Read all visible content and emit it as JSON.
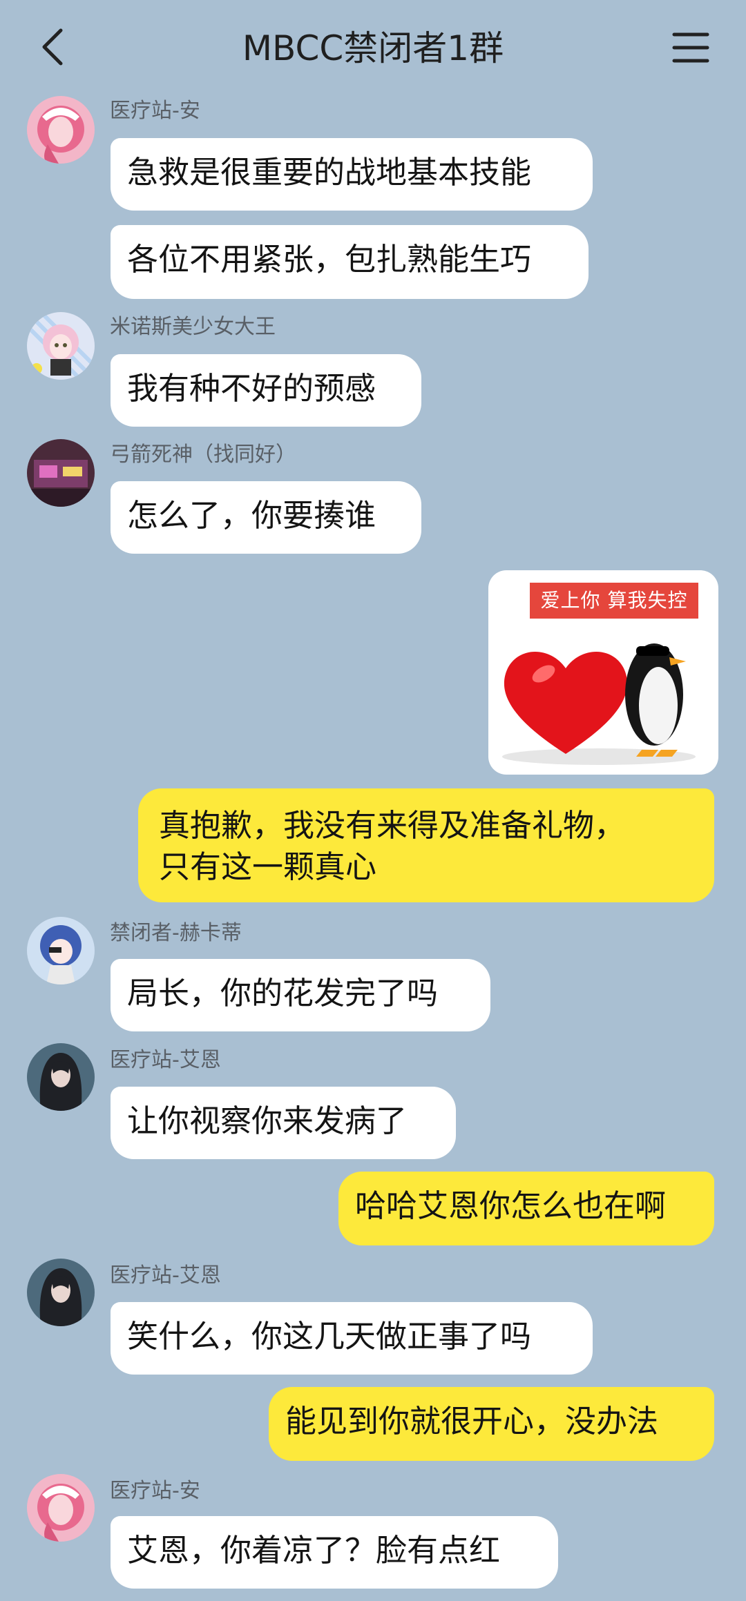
{
  "header": {
    "title": "MBCC禁闭者1群",
    "back_icon": "chevron-left-icon",
    "menu_icon": "menu-icon"
  },
  "messages": [
    {
      "side": "left",
      "sender": "医疗站-安",
      "text": "急救是很重要的战地基本技能"
    },
    {
      "side": "left",
      "sender": "医疗站-安",
      "text": "各位不用紧张，包扎熟能生巧"
    },
    {
      "side": "left",
      "sender": "米诺斯美少女大王",
      "text": "我有种不好的预感"
    },
    {
      "side": "left",
      "sender": "弓箭死神（找同好）",
      "text": "怎么了，你要揍谁"
    },
    {
      "side": "right",
      "type": "sticker",
      "caption": "爱上你  算我失控"
    },
    {
      "side": "right",
      "text_line1": "真抱歉，我没有来得及准备礼物，",
      "text_line2": "只有这一颗真心"
    },
    {
      "side": "left",
      "sender": "禁闭者-赫卡蒂",
      "text": "局长，你的花发完了吗"
    },
    {
      "side": "left",
      "sender": "医疗站-艾恩",
      "text": "让你视察你来发病了"
    },
    {
      "side": "right",
      "text": "哈哈艾恩你怎么也在啊"
    },
    {
      "side": "left",
      "sender": "医疗站-艾恩",
      "text": "笑什么，你这几天做正事了吗"
    },
    {
      "side": "right",
      "text": "能见到你就很开心，没办法"
    },
    {
      "side": "left",
      "sender": "医疗站-安",
      "text": "艾恩，你着凉了？脸有点红"
    }
  ],
  "colors": {
    "background": "#a9bfd2",
    "left_bubble": "#ffffff",
    "right_bubble": "#fde93b",
    "sticker_caption": "#e5463c"
  }
}
